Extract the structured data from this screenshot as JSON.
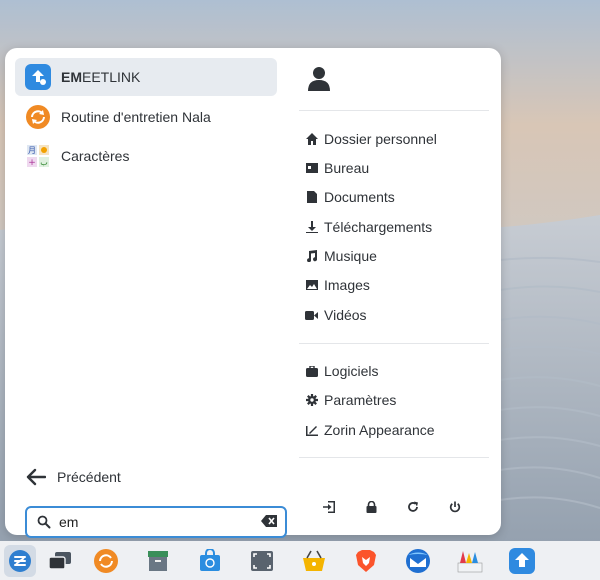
{
  "search": {
    "query": "em"
  },
  "results": [
    {
      "bold": "EM",
      "rest": "EETLINK",
      "icon": "emeetlink-icon"
    },
    {
      "bold": "",
      "rest": "Routine d'entretien Nala",
      "icon": "nala-update-icon"
    },
    {
      "bold": "",
      "rest": "Caractères",
      "icon": "characters-icon"
    }
  ],
  "back_label": "Précédent",
  "places": [
    {
      "label": "Dossier personnel",
      "icon": "home-icon"
    },
    {
      "label": "Bureau",
      "icon": "desktop-icon"
    },
    {
      "label": "Documents",
      "icon": "document-icon"
    },
    {
      "label": "Téléchargements",
      "icon": "download-icon"
    },
    {
      "label": "Musique",
      "icon": "music-icon"
    },
    {
      "label": "Images",
      "icon": "image-icon"
    },
    {
      "label": "Vidéos",
      "icon": "video-icon"
    }
  ],
  "system": [
    {
      "label": "Logiciels",
      "icon": "software-icon"
    },
    {
      "label": "Paramètres",
      "icon": "settings-gear-icon"
    },
    {
      "label": "Zorin Appearance",
      "icon": "appearance-icon"
    }
  ],
  "colors": {
    "accent": "#3b8cd6",
    "text": "#2f3338",
    "menu_bg": "#ffffff"
  }
}
